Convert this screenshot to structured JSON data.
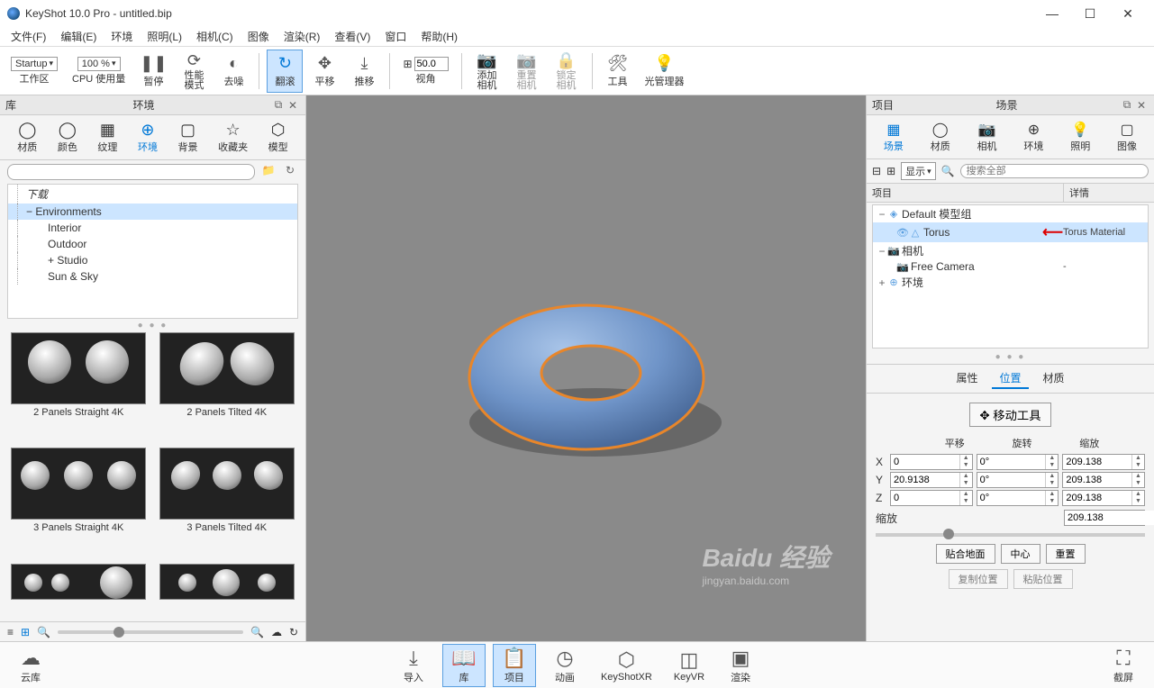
{
  "title": "KeyShot 10.0 Pro  - untitled.bip",
  "menu": [
    "文件(F)",
    "编辑(E)",
    "环境",
    "照明(L)",
    "相机(C)",
    "图像",
    "渲染(R)",
    "查看(V)",
    "窗口",
    "帮助(H)"
  ],
  "toolbar": {
    "workspace_combo": "Startup",
    "workspace_label": "工作区",
    "cpu_combo": "100 %",
    "cpu_label": "CPU 使用量",
    "pause": "暂停",
    "perf": "性能\n模式",
    "denoise": "去噪",
    "tumble": "翻滚",
    "pan": "平移",
    "dolly": "推移",
    "fov_val": "50.0",
    "fov_label": "视角",
    "addcam": "添加\n相机",
    "resetcam": "重置\n相机",
    "lockcam": "锁定\n相机",
    "tools": "工具",
    "lightmgr": "光管理器"
  },
  "left": {
    "name": "库",
    "head": "环境",
    "tabs": [
      {
        "l": "材质"
      },
      {
        "l": "颜色"
      },
      {
        "l": "纹理"
      },
      {
        "l": "环境"
      },
      {
        "l": "背景"
      },
      {
        "l": "收藏夹"
      },
      {
        "l": "模型"
      }
    ],
    "search_ph": "",
    "tree": {
      "download": "下载",
      "env": "Environments",
      "interior": "Interior",
      "outdoor": "Outdoor",
      "studio": "Studio",
      "sunsky": "Sun & Sky"
    },
    "thumbs": [
      "2 Panels Straight 4K",
      "2 Panels Tilted 4K",
      "3 Panels Straight 4K",
      "3 Panels Tilted 4K"
    ]
  },
  "right": {
    "name": "项目",
    "head": "场景",
    "tabs": [
      {
        "l": "场景"
      },
      {
        "l": "材质"
      },
      {
        "l": "相机"
      },
      {
        "l": "环境"
      },
      {
        "l": "照明"
      },
      {
        "l": "图像"
      }
    ],
    "display": "显示",
    "search_ph": "搜索全部",
    "cols": {
      "c1": "项目",
      "c2": "详情"
    },
    "tree": {
      "modelset": "Default 模型组",
      "torus": "Torus",
      "torus_mat": "Torus Material",
      "cam": "相机",
      "freecam": "Free Camera",
      "freecam_det": "-",
      "env": "环境"
    },
    "prop_tabs": [
      "属性",
      "位置",
      "材质"
    ],
    "move_tool": "移动工具",
    "xform_heads": [
      "平移",
      "旋转",
      "缩放"
    ],
    "rows": [
      {
        "ax": "X",
        "t": "0",
        "r": "0°",
        "s": "209.138"
      },
      {
        "ax": "Y",
        "t": "20.9138",
        "r": "0°",
        "s": "209.138"
      },
      {
        "ax": "Z",
        "t": "0",
        "r": "0°",
        "s": "209.138"
      }
    ],
    "scale_label": "缩放",
    "scale_val": "209.138",
    "btns1": [
      "贴合地面",
      "中心",
      "重置"
    ],
    "btns2": [
      "复制位置",
      "粘贴位置"
    ]
  },
  "bottom": {
    "cloud": "云库",
    "import": "导入",
    "lib": "库",
    "proj": "项目",
    "anim": "动画",
    "kxr": "KeyShotXR",
    "kvr": "KeyVR",
    "render": "渲染",
    "screenshot": "截屏"
  },
  "watermark": {
    "main": "Baidu 经验",
    "sub": "jingyan.baidu.com"
  }
}
